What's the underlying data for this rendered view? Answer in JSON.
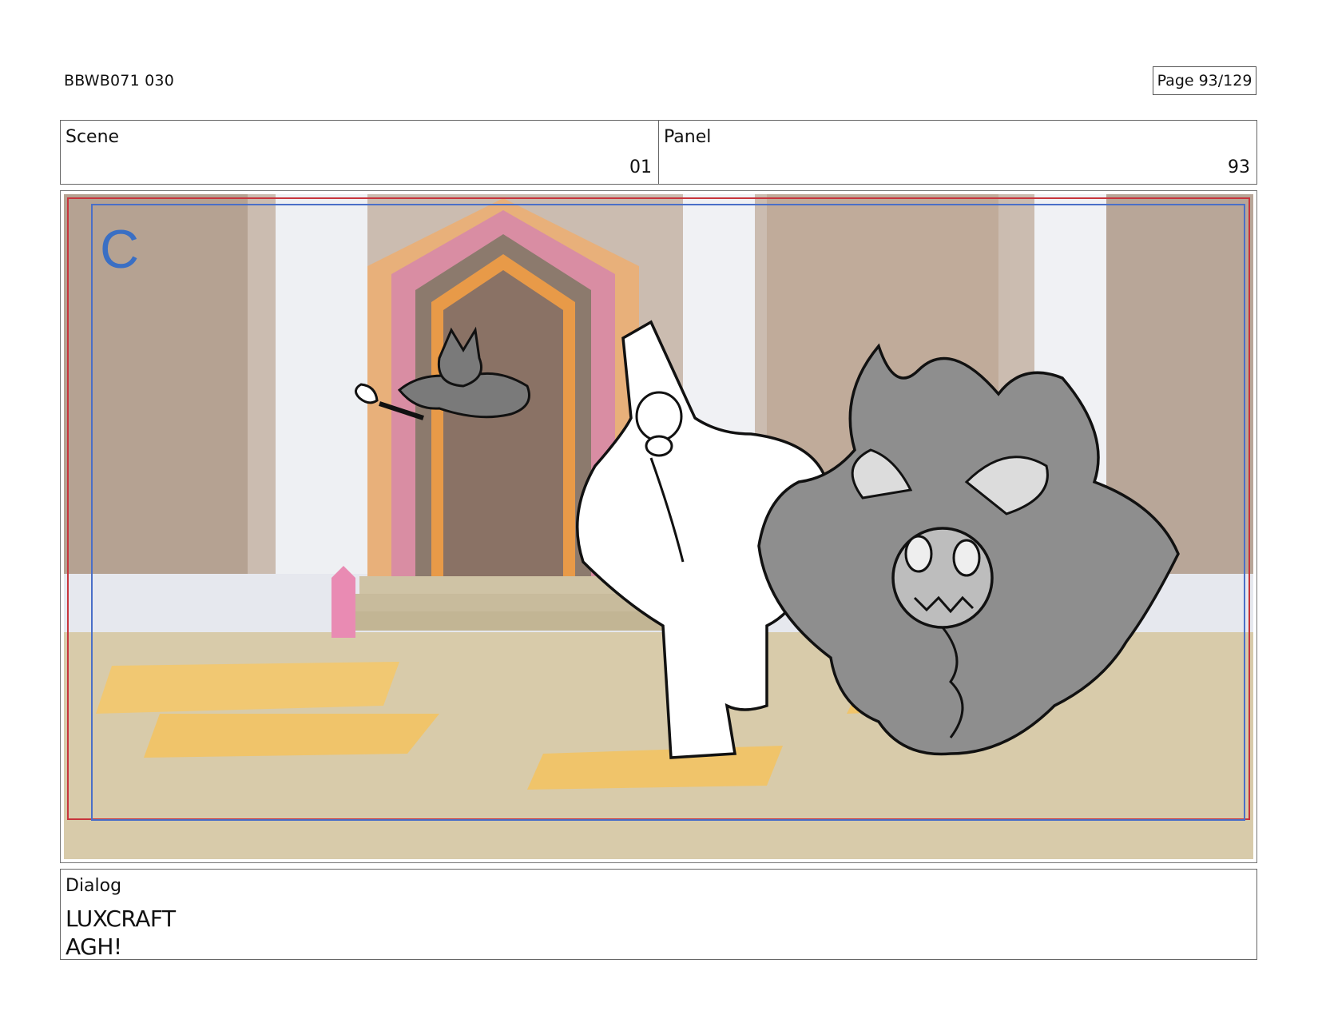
{
  "header": {
    "code": "BBWB071 030",
    "page_word": "Page",
    "page_number": "93/129"
  },
  "scene": {
    "label": "Scene",
    "value": "01"
  },
  "panel": {
    "label": "Panel",
    "value": "93"
  },
  "frame": {
    "field_letter": "C"
  },
  "dialog": {
    "label": "Dialog",
    "lines": [
      "LUXCRAFT",
      "AGH!"
    ]
  },
  "colors": {
    "field_marker": "#3a6fc4",
    "safe_frame_red": "#c8343c",
    "safe_frame_blue": "#4a6fc8"
  }
}
